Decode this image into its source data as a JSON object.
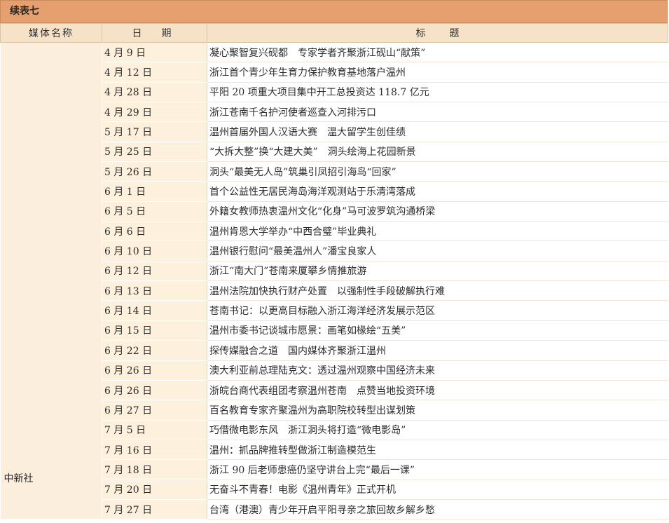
{
  "table_title": "续表七",
  "headers": {
    "media": "媒体名称",
    "date": "日期",
    "title": "标题"
  },
  "media_name": "中新社",
  "rows": [
    {
      "date": "4 月 9 日",
      "title": "凝心聚智复兴砚都　专家学者齐聚浙江砚山“献策”"
    },
    {
      "date": "4 月 12 日",
      "title": "浙江首个青少年生育力保护教育基地落户温州"
    },
    {
      "date": "4 月 28 日",
      "title": "平阳 20 项重大项目集中开工总投资达 118.7 亿元"
    },
    {
      "date": "4 月 29 日",
      "title": "浙江苍南千名护河使者巡查入河排污口"
    },
    {
      "date": "5 月 17 日",
      "title": "温州首届外国人汉语大赛　温大留学生创佳绩"
    },
    {
      "date": "5 月 25 日",
      "title": "“大拆大整”换“大建大美”　洞头绘海上花园新景"
    },
    {
      "date": "5 月 26 日",
      "title": "洞头“最美无人岛”筑巢引凤招引海鸟“回家”"
    },
    {
      "date": "6 月 1 日",
      "title": "首个公益性无居民海岛海洋观测站于乐清湾落成"
    },
    {
      "date": "6 月 5 日",
      "title": "外籍女教师热衷温州文化“化身”马可波罗筑沟通桥梁"
    },
    {
      "date": "6 月 6 日",
      "title": "温州肯恩大学举办“中西合璧”毕业典礼"
    },
    {
      "date": "6 月 10 日",
      "title": "温州银行慰问“最美温州人”潘宝良家人"
    },
    {
      "date": "6 月 12 日",
      "title": "浙江“南大门”苍南来厦攀乡情推旅游"
    },
    {
      "date": "6 月 13 日",
      "title": "温州法院加快执行财产处置　以强制性手段破解执行难"
    },
    {
      "date": "6 月 14 日",
      "title": "苍南书记：以更高目标融入浙江海洋经济发展示范区"
    },
    {
      "date": "6 月 15 日",
      "title": "温州市委书记谈城市愿景：画笔如椽绘“五美”"
    },
    {
      "date": "6 月 22 日",
      "title": "探传媒融合之道　国内媒体齐聚浙江温州"
    },
    {
      "date": "6 月 26 日",
      "title": "澳大利亚前总理陆克文：透过温州观察中国经济未来"
    },
    {
      "date": "6 月 26 日",
      "title": "浙皖台商代表组团考察温州苍南　点赞当地投资环境"
    },
    {
      "date": "6 月 27 日",
      "title": "百名教育专家齐聚温州为高职院校转型出谋划策"
    },
    {
      "date": "7 月 5 日",
      "title": "巧借微电影东风　浙江洞头将打造“微电影岛”"
    },
    {
      "date": "7 月 16 日",
      "title": "温州：抓品牌推转型做浙江制造模范生"
    },
    {
      "date": "7 月 18 日",
      "title": "浙江 90 后老师患癌仍坚守讲台上完“最后一课”"
    },
    {
      "date": "7 月 20 日",
      "title": "无奋斗不青春！电影《温州青年》正式开机"
    },
    {
      "date": "7 月 27 日",
      "title": "台湾（港澳）青少年开启平阳寻亲之旅回故乡解乡愁"
    }
  ]
}
